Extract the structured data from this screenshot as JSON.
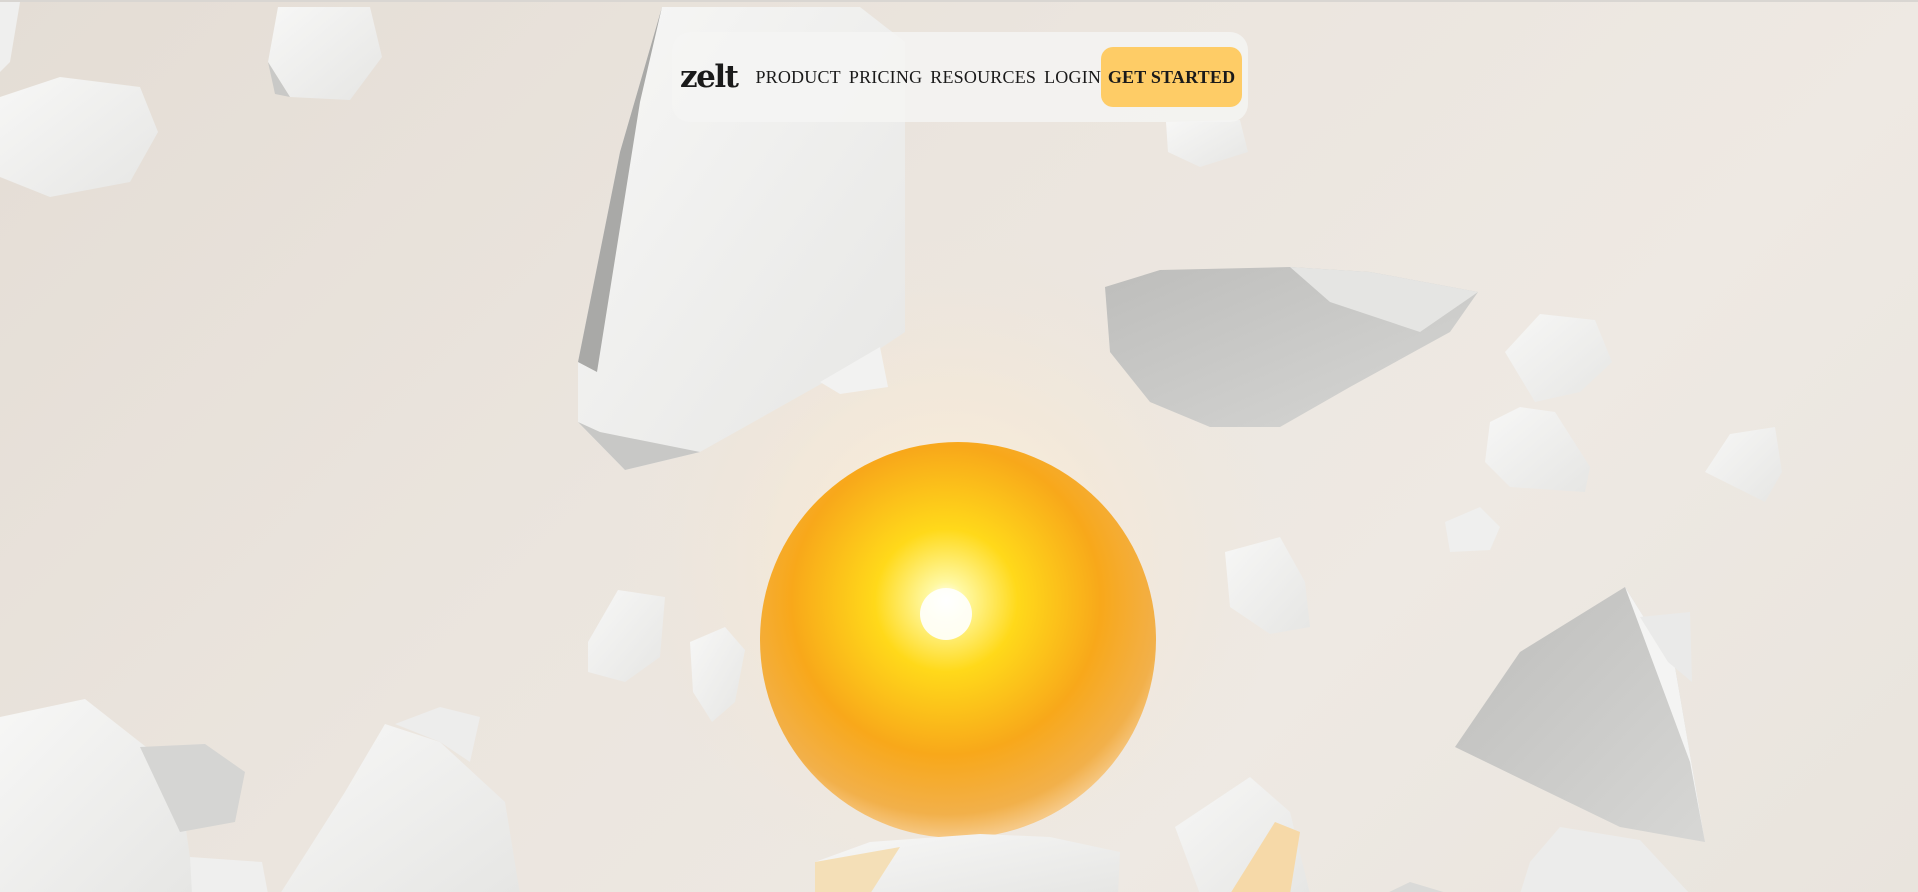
{
  "brand": {
    "logo_text": "zelt"
  },
  "nav": {
    "links": [
      {
        "label": "PRODUCT"
      },
      {
        "label": "PRICING"
      },
      {
        "label": "RESOURCES"
      },
      {
        "label": "LOGIN"
      }
    ],
    "cta_label": "GET STARTED"
  },
  "colors": {
    "cta_background": "#fecc66",
    "text": "#1a1a1a",
    "background": "#ebe5de",
    "orb": "#f8a81a"
  }
}
